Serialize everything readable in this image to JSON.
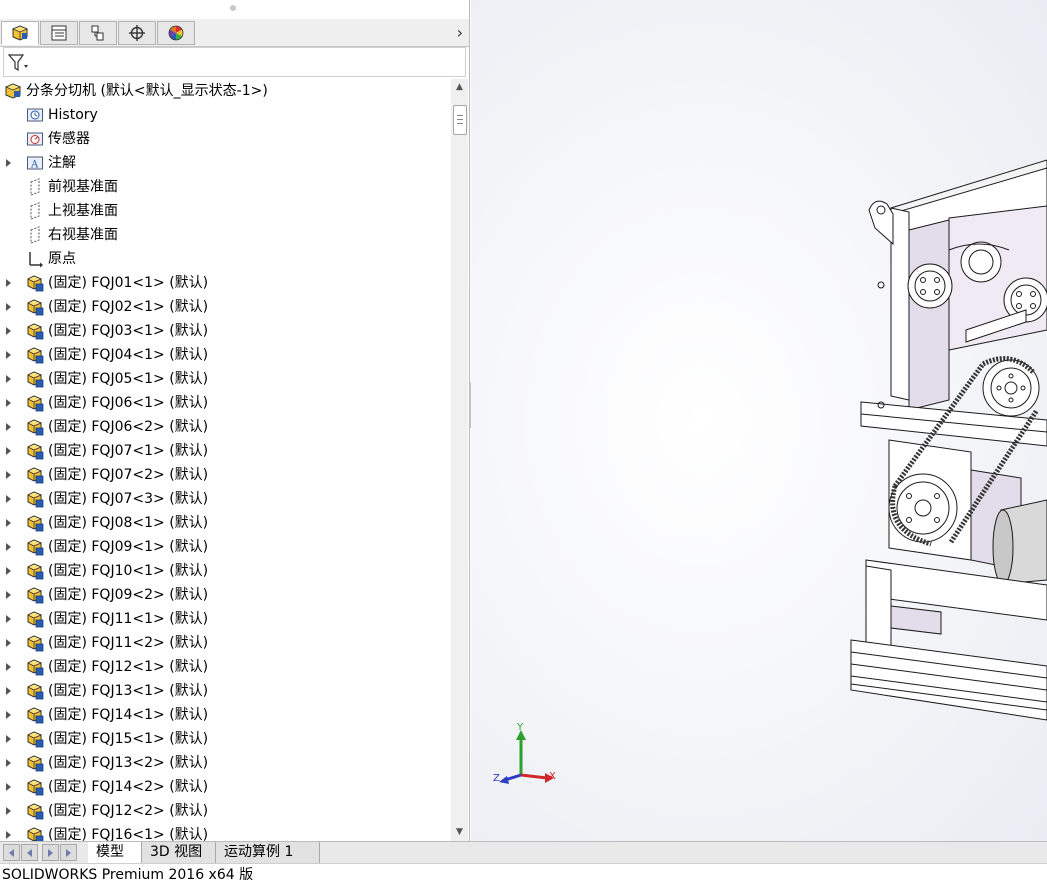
{
  "panel": {
    "tabs": [
      {
        "icon": "feature-manager-icon"
      },
      {
        "icon": "property-manager-icon"
      },
      {
        "icon": "configuration-manager-icon"
      },
      {
        "icon": "dimxpert-manager-icon"
      },
      {
        "icon": "display-manager-icon"
      }
    ],
    "expand_glyph": "›"
  },
  "tree": {
    "root": "分条分切机  (默认<默认_显示状态-1>)",
    "items": [
      {
        "label": "History",
        "icon": "history-folder-icon",
        "caret": false
      },
      {
        "label": "传感器",
        "icon": "sensors-folder-icon",
        "caret": false
      },
      {
        "label": "注解",
        "icon": "annotations-folder-icon",
        "caret": true
      },
      {
        "label": "前视基准面",
        "icon": "plane-icon",
        "caret": false
      },
      {
        "label": "上视基准面",
        "icon": "plane-icon",
        "caret": false
      },
      {
        "label": "右视基准面",
        "icon": "plane-icon",
        "caret": false
      },
      {
        "label": "原点",
        "icon": "origin-icon",
        "caret": false
      }
    ],
    "components": [
      "(固定) FQJ01<1> (默认)",
      "(固定) FQJ02<1> (默认)",
      "(固定) FQJ03<1> (默认)",
      "(固定) FQJ04<1> (默认)",
      "(固定) FQJ05<1> (默认)",
      "(固定) FQJ06<1> (默认)",
      "(固定) FQJ06<2> (默认)",
      "(固定) FQJ07<1> (默认)",
      "(固定) FQJ07<2> (默认)",
      "(固定) FQJ07<3> (默认)",
      "(固定) FQJ08<1> (默认)",
      "(固定) FQJ09<1> (默认)",
      "(固定) FQJ10<1> (默认)",
      "(固定) FQJ09<2> (默认)",
      "(固定) FQJ11<1> (默认)",
      "(固定) FQJ11<2> (默认)",
      "(固定) FQJ12<1> (默认)",
      "(固定) FQJ13<1> (默认)",
      "(固定) FQJ14<1> (默认)",
      "(固定) FQJ15<1> (默认)",
      "(固定) FQJ13<2> (默认)",
      "(固定) FQJ14<2> (默认)",
      "(固定) FQJ12<2> (默认)",
      "(固定) FQJ16<1> (默认)"
    ]
  },
  "triad": {
    "x": "X",
    "y": "Y",
    "z": "Z"
  },
  "bottom_tabs": [
    "模型",
    "3D 视图",
    "运动算例 1"
  ],
  "status": "SOLIDWORKS Premium 2016 x64 版",
  "colors": {
    "accent_blue": "#2a5db0",
    "part_yellow": "#f2c232",
    "machine_panel": "#e2dceb",
    "line": "#1a1a1a"
  }
}
